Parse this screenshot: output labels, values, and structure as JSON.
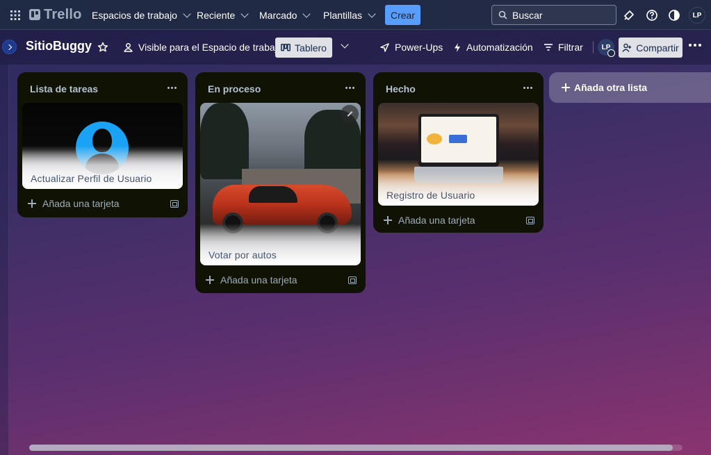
{
  "topbar": {
    "app_name": "Trello",
    "nav": [
      {
        "label": "Espacios de trabajo"
      },
      {
        "label": "Reciente"
      },
      {
        "label": "Marcado"
      },
      {
        "label": "Plantillas"
      }
    ],
    "create_label": "Crear",
    "search_placeholder": "Buscar",
    "user_initials": "LP"
  },
  "board": {
    "title": "SitioBuggy",
    "visibility_label": "Visible para el Espacio de trabajo",
    "view_label": "Tablero",
    "powerups_label": "Power-Ups",
    "automation_label": "Automatización",
    "filter_label": "Filtrar",
    "member_initials": "LP",
    "share_label": "Compartir"
  },
  "lists": [
    {
      "title": "Lista de tareas",
      "cards": [
        {
          "title": "Actualizar Perfil de Usuario"
        }
      ],
      "add_card_label": "Añada una tarjeta"
    },
    {
      "title": "En proceso",
      "cards": [
        {
          "title": "Votar por autos"
        }
      ],
      "add_card_label": "Añada una tarjeta"
    },
    {
      "title": "Hecho",
      "cards": [
        {
          "title": "Registro de Usuario"
        }
      ],
      "add_card_label": "Añada una tarjeta"
    }
  ],
  "add_list_label": "Añada otra lista",
  "colors": {
    "accent": "#579dff",
    "list_bg": "#101204",
    "header_bg": "#1f2a44"
  },
  "icons": {
    "apps": "apps-grid-icon",
    "search": "search-icon",
    "notifications": "bell-icon",
    "help": "help-icon",
    "theme": "theme-icon",
    "star": "star-icon",
    "visibility": "people-icon",
    "view": "board-icon",
    "powerups": "rocket-icon",
    "automation": "bolt-icon",
    "filter": "filter-icon",
    "share": "add-person-icon",
    "more": "more-icon"
  }
}
